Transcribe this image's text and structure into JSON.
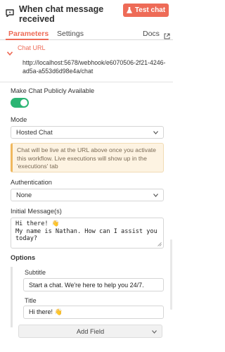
{
  "header": {
    "title": "When chat message received",
    "icon": "chat-bolt-icon",
    "test_button_label": "Test chat",
    "test_button_icon": "flask-icon",
    "accent_color": "#ee6b57"
  },
  "tabs": {
    "parameters": "Parameters",
    "settings": "Settings",
    "docs": "Docs",
    "docs_icon": "external-link-icon",
    "active": "Parameters"
  },
  "chat_url": {
    "label": "Chat URL",
    "value": "http://localhost:5678/webhook/e6070506-2f21-4246-ad5a-a553d6d98e4a/chat",
    "expanded": true
  },
  "public": {
    "label": "Make Chat Publicly Available",
    "enabled": true,
    "toggle_color": "#2bb573"
  },
  "mode": {
    "label": "Mode",
    "value": "Hosted Chat"
  },
  "notice": {
    "text": "Chat will be live at the URL above once you activate this workflow. Live executions will show up in the 'executions' tab"
  },
  "authentication": {
    "label": "Authentication",
    "value": "None"
  },
  "initial_messages": {
    "label": "Initial Message(s)",
    "value": "Hi there! 👋\nMy name is Nathan. How can I assist you today?"
  },
  "options": {
    "label": "Options",
    "subtitle_label": "Subtitle",
    "subtitle_value": "Start a chat. We're here to help you 24/7.",
    "title_label": "Title",
    "title_value": "Hi there! 👋",
    "add_field_label": "Add Field"
  }
}
